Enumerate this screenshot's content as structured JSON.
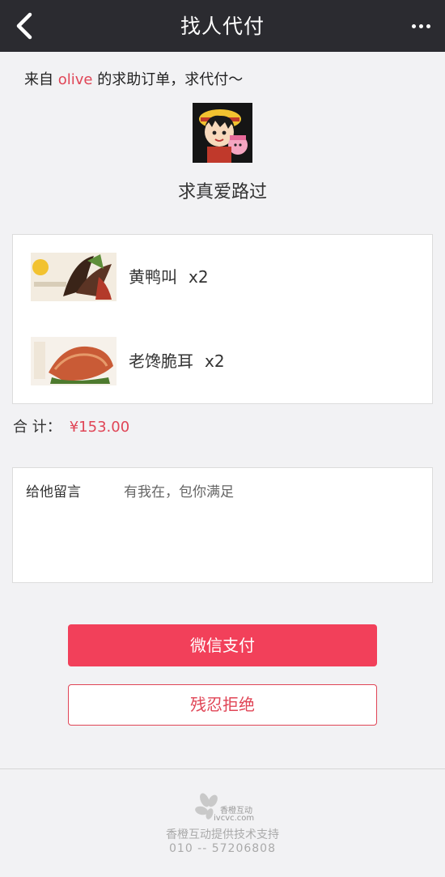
{
  "nav": {
    "title": "找人代付"
  },
  "request": {
    "prefix": "来自 ",
    "user": "olive",
    "suffix": " 的求助订单，求代付～"
  },
  "headline": "求真爱路过",
  "items": [
    {
      "name": "黄鸭叫",
      "qty": "x2"
    },
    {
      "name": "老馋脆耳",
      "qty": "x2"
    }
  ],
  "total": {
    "label": "合 计：",
    "amount": "¥153.00"
  },
  "message": {
    "label": "给他留言",
    "text": "有我在，包你满足"
  },
  "buttons": {
    "pay": "微信支付",
    "reject": "残忍拒绝"
  },
  "footer": {
    "brand_name": "香橙互动",
    "brand_url": "ivcvc.com",
    "support": "香橙互动提供技术支持",
    "phone": "010 -- 57206808"
  },
  "colors": {
    "accent": "#f2405a",
    "nav_bg": "#2b2b30"
  }
}
